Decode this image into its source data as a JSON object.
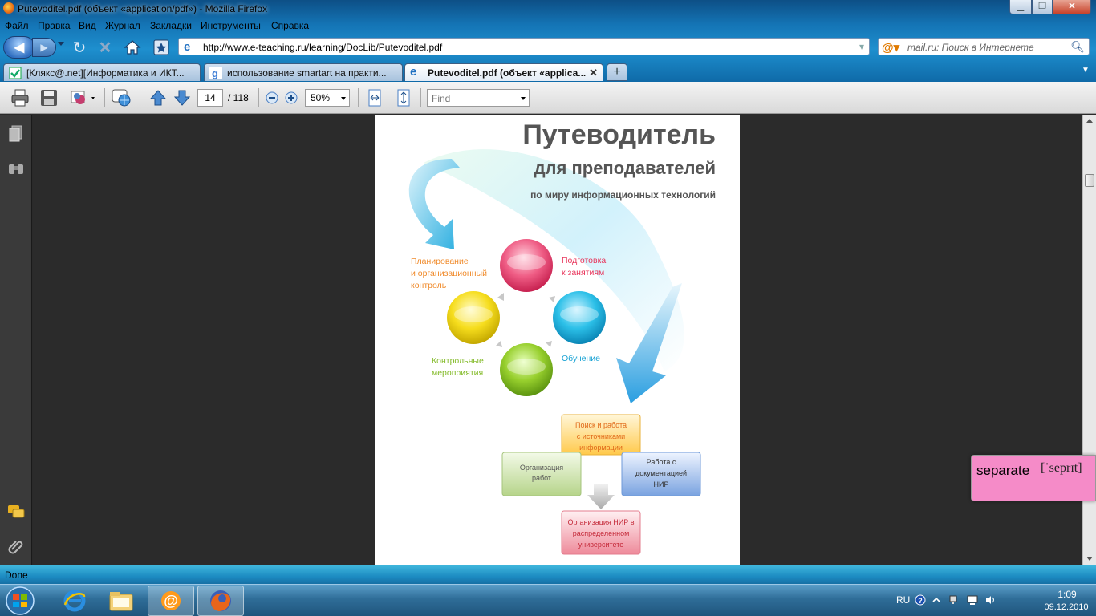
{
  "window": {
    "title": "Putevoditel.pdf (объект «application/pdf») - Mozilla Firefox"
  },
  "menu": [
    "Файл",
    "Правка",
    "Вид",
    "Журнал",
    "Закладки",
    "Инструменты",
    "Справка"
  ],
  "nav": {
    "url": "http://www.e-teaching.ru/learning/DocLib/Putevoditel.pdf",
    "search_placeholder": "mail.ru: Поиск в Интернете"
  },
  "tabs": [
    {
      "label": "[Клякс@.net][Информатика и ИКТ...",
      "icon": "klyaksa-favicon",
      "active": false
    },
    {
      "label": "использование smartart на практи...",
      "icon": "google-favicon",
      "active": false
    },
    {
      "label": "Putevoditel.pdf (объект «applica...",
      "icon": "ie-page-icon",
      "active": true
    }
  ],
  "pdf_toolbar": {
    "page_current": "14",
    "page_total": "/ 118",
    "zoom": "50%",
    "find_placeholder": "Find"
  },
  "document": {
    "title": "Путеводитель",
    "subtitle": "для преподавателей",
    "tagline": "по миру информационных технологий",
    "cycle_labels": {
      "planning_line1": "Планирование",
      "planning_line2": "и организационный",
      "planning_line3": "контроль",
      "preparation_line1": "Подготовка",
      "preparation_line2": "к занятиям",
      "training": "Обучение",
      "control_line1": "Контрольные",
      "control_line2": "мероприятия"
    },
    "boxes": {
      "search_line1": "Поиск и работа",
      "search_line2": "с источниками",
      "search_line3": "информации",
      "org_line1": "Организация",
      "org_line2": "работ",
      "docs_line1": "Работа с",
      "docs_line2": "документацией",
      "docs_line3": "НИР",
      "nir_line1": "Организация НИР в",
      "nir_line2": "распределенном",
      "nir_line3": "университете"
    },
    "colors": {
      "red": "#e8456f",
      "blue": "#1bb0d8",
      "green": "#8bc22c",
      "yellow": "#f0d418",
      "orange_text": "#f08a2a",
      "red_text": "#e8345a",
      "blue_text": "#1aa3d4",
      "green_text": "#84bb2a"
    }
  },
  "dictionary_popup": {
    "word": "separate",
    "transcription": "[ˈseprɪt]"
  },
  "status": "Done",
  "tray": {
    "lang": "RU",
    "time": "1:09",
    "date": "09.12.2010"
  }
}
